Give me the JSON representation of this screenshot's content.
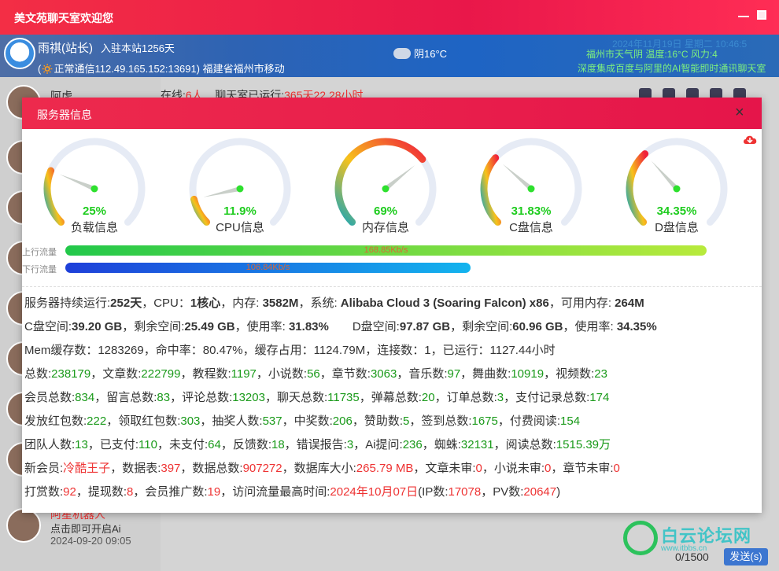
{
  "app": {
    "title": "美文苑聊天室欢迎您"
  },
  "user": {
    "name": "雨祺(站长)",
    "days": "入驻本站1256天",
    "conn": "(🔅正常通信112.49.165.152:13691)",
    "location": "福建省福州市移动"
  },
  "weather": {
    "text": "阴16°C"
  },
  "datetime": "2024年11月19日 星期二 10:46:5",
  "city_weather": "福州市天气阴 温度:16°C 风力:4",
  "ai_banner": "深度集成百度与阿里的AI智能即时通讯聊天室",
  "chat": {
    "online_label": "在线:",
    "online_count": "6人",
    "runtime_label": "聊天室已运行:",
    "runtime_value": "365天22.28小时",
    "counter": "0/1500",
    "send": "发送(s)"
  },
  "sidebar": {
    "first_user": "阿虎",
    "bottom_user": "阿星机器人",
    "bottom_line": "点击即可开启Ai",
    "bottom_time": "2024-09-20 09:05"
  },
  "modal": {
    "title": "服务器信息",
    "close": "×",
    "upload_label": "上行流量",
    "download_label": "下行流量",
    "upload_value": "168.85Kb/s",
    "download_value": "106.84Kb/s",
    "upload_fraction": 0.87,
    "download_fraction": 0.55
  },
  "gauges": [
    {
      "value": "25%",
      "pct": 25,
      "label": "负载信息"
    },
    {
      "value": "11.9%",
      "pct": 11.9,
      "label": "CPU信息"
    },
    {
      "value": "69%",
      "pct": 69,
      "label": "内存信息"
    },
    {
      "value": "31.83%",
      "pct": 31.83,
      "label": "C盘信息"
    },
    {
      "value": "34.35%",
      "pct": 34.35,
      "label": "D盘信息"
    }
  ],
  "stats": {
    "l1": {
      "a": "服务器持续运行:",
      "b": "252天",
      "c": "，CPU：",
      "d": "1核心",
      "e": "，内存: ",
      "f": "3582M",
      "g": "，系统: ",
      "h": "Alibaba Cloud 3 (Soaring Falcon) x86",
      "i": "，可用内存: ",
      "j": "264M"
    },
    "l2": {
      "a": "C盘空间:",
      "b": "39.20 GB",
      "c": "，剩余空间:",
      "d": "25.49 GB",
      "e": "，使用率: ",
      "f": "31.83%",
      "g": "D盘空间:",
      "h": "97.87 GB",
      "i": "，剩余空间:",
      "j": "60.96 GB",
      "k": "，使用率: ",
      "l": "34.35%"
    },
    "l3": "Mem缓存数：1283269，命中率：80.47%，缓存占用：1124.79M，连接数：1，已运行：1127.44小时",
    "l4": [
      [
        "总数:",
        "238179"
      ],
      [
        "，文章数:",
        "222799"
      ],
      [
        "，教程数:",
        "1197"
      ],
      [
        "，小说数:",
        "56"
      ],
      [
        "，章节数:",
        "3063"
      ],
      [
        "，音乐数:",
        "97"
      ],
      [
        "，舞曲数:",
        "10919"
      ],
      [
        "，视频数:",
        "23"
      ]
    ],
    "l5": [
      [
        "会员总数:",
        "834"
      ],
      [
        "，留言总数:",
        "83"
      ],
      [
        "，评论总数:",
        "13203"
      ],
      [
        "，聊天总数:",
        "11735"
      ],
      [
        "，弹幕总数:",
        "20"
      ],
      [
        "，订单总数:",
        "3"
      ],
      [
        "，支付记录总数:",
        "174"
      ]
    ],
    "l6": [
      [
        "发放红包数:",
        "222"
      ],
      [
        "，领取红包数:",
        "303"
      ],
      [
        "，抽奖人数:",
        "537"
      ],
      [
        "，中奖数:",
        "206"
      ],
      [
        "，赞助数:",
        "5"
      ],
      [
        "，签到总数:",
        "1675"
      ],
      [
        "，付费阅读:",
        "154"
      ]
    ],
    "l7": [
      [
        "团队人数:",
        "13"
      ],
      [
        "，已支付:",
        "110"
      ],
      [
        "，未支付:",
        "64"
      ],
      [
        "，反馈数:",
        "18"
      ],
      [
        "，错误报告:",
        "3"
      ],
      [
        "，Ai提问:",
        "236"
      ],
      [
        "，蜘蛛:",
        "32131"
      ],
      [
        "，阅读总数:",
        "1515.39万"
      ]
    ],
    "l8": [
      [
        "新会员:",
        "冷酷王子"
      ],
      [
        "，数据表:",
        "397"
      ],
      [
        "，数据总数:",
        "907272"
      ],
      [
        "，数据库大小:",
        "265.79 MB"
      ],
      [
        "，文章未审:",
        "0"
      ],
      [
        "，小说未审:",
        "0"
      ],
      [
        "，章节未审:",
        "0"
      ]
    ],
    "l9": [
      [
        "打赏数:",
        "92"
      ],
      [
        "，提现数:",
        "8"
      ],
      [
        "，会员推广数:",
        "19"
      ],
      [
        "，访问流量最高时间:",
        "2024年10月07日"
      ],
      [
        "(IP数:",
        "17078"
      ],
      [
        "，PV数:",
        "20647"
      ],
      [
        ")",
        ""
      ]
    ]
  },
  "watermark": {
    "text": "白云论坛网",
    "sub": "www.itbbs.cn"
  },
  "colors": {
    "accent": "#e9174a",
    "green": "#1a9a1a",
    "red": "#e33333"
  }
}
